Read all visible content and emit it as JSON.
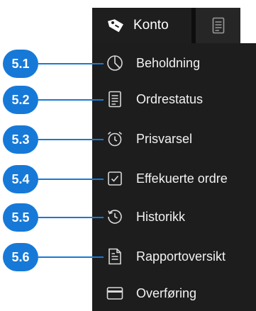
{
  "header": {
    "account_tab_label": "Konto",
    "account_icon": "tag-icon",
    "document_icon": "document-icon"
  },
  "menu": {
    "items": [
      {
        "label": "Beholdning",
        "icon": "pie-chart-icon"
      },
      {
        "label": "Ordrestatus",
        "icon": "document-list-icon"
      },
      {
        "label": "Prisvarsel",
        "icon": "alarm-clock-icon"
      },
      {
        "label": "Effekuerte ordre",
        "icon": "checkbox-icon"
      },
      {
        "label": "Historikk",
        "icon": "history-icon"
      },
      {
        "label": "Rapportoversikt",
        "icon": "report-icon"
      },
      {
        "label": "Overføring",
        "icon": "card-icon"
      }
    ]
  },
  "annotations": [
    "5.1",
    "5.2",
    "5.3",
    "5.4",
    "5.5",
    "5.6"
  ],
  "colors": {
    "menu_background": "#1d1d1d",
    "tab_background": "#1e1e1e",
    "badge": "#1679d8",
    "text": "#f2f2f2"
  }
}
